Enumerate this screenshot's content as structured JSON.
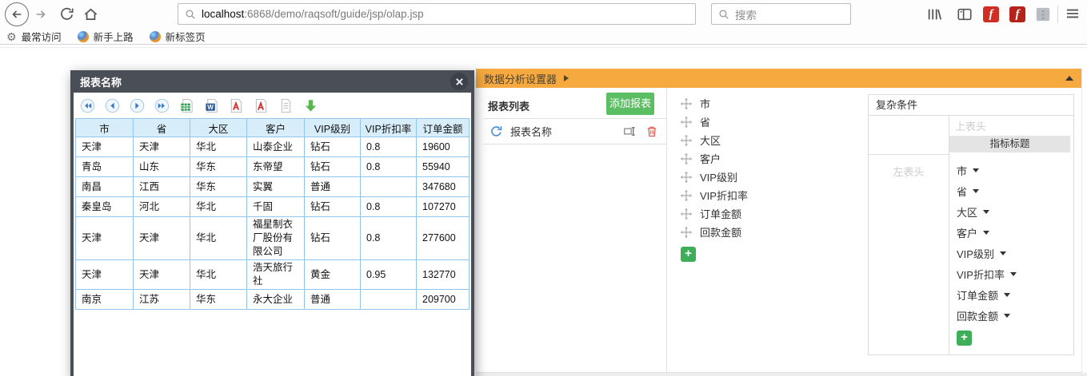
{
  "browser": {
    "url": {
      "host": "localhost",
      "path": ":6868/demo/raqsoft/guide/jsp/olap.jsp"
    },
    "search_placeholder": "搜索",
    "bookmarks": [
      "最常访问",
      "新手上路",
      "新标签页"
    ],
    "toolbar_icons": [
      "back-icon",
      "forward-icon",
      "refresh-icon",
      "home-icon",
      "search-icon",
      "library-icon",
      "sidebar-icon",
      "flash-icon",
      "flash-icon",
      "addon-icon",
      "menu-icon"
    ]
  },
  "dialog": {
    "title": "报表名称",
    "toolbar_icons": [
      "first-page-icon",
      "prev-page-icon",
      "next-page-icon",
      "last-page-icon",
      "export-excel-icon",
      "export-word-icon",
      "export-pdf-icon",
      "print-pdf-icon",
      "paper-icon",
      "download-icon"
    ],
    "table": {
      "headers": [
        "市",
        "省",
        "大区",
        "客户",
        "VIP级别",
        "VIP折扣率",
        "订单金额"
      ],
      "rows": [
        [
          "天津",
          "天津",
          "华北",
          "山泰企业",
          "钻石",
          "0.8",
          "19600"
        ],
        [
          "青岛",
          "山东",
          "华东",
          "东帝望",
          "钻石",
          "0.8",
          "55940"
        ],
        [
          "南昌",
          "江西",
          "华东",
          "实翼",
          "普通",
          "",
          "347680"
        ],
        [
          "秦皇岛",
          "河北",
          "华北",
          "千固",
          "钻石",
          "0.8",
          "107270"
        ],
        [
          "天津",
          "天津",
          "华北",
          "福星制衣厂股份有限公司",
          "钻石",
          "0.8",
          "277600"
        ],
        [
          "天津",
          "天津",
          "华北",
          "浩天旅行社",
          "黄金",
          "0.95",
          "132770"
        ],
        [
          "南京",
          "江苏",
          "华东",
          "永大企业",
          "普通",
          "",
          "209700"
        ]
      ]
    }
  },
  "panel": {
    "title": "数据分析设置器",
    "report_list": {
      "header": "报表列表",
      "add_button": "添加报表",
      "items": [
        "报表名称"
      ]
    },
    "fields": [
      "市",
      "省",
      "大区",
      "客户",
      "VIP级别",
      "VIP折扣率",
      "订单金额",
      "回款金额"
    ],
    "condition": {
      "title": "复杂条件",
      "top_header_placeholder": "上表头",
      "metric_title": "指标标题",
      "left_header_placeholder": "左表头",
      "fields": [
        "市",
        "省",
        "大区",
        "客户",
        "VIP级别",
        "VIP折扣率",
        "订单金额",
        "回款金额"
      ]
    }
  },
  "colors": {
    "accent_orange": "#F6A93E",
    "button_green": "#5CBE63",
    "plus_green": "#3FAE58",
    "trash_red": "#E0574A",
    "refresh_blue": "#4A90D9",
    "table_border": "#92C6EA",
    "table_header_bg": "#D8EDFA",
    "dialog_titlebar": "#4A4E57"
  }
}
